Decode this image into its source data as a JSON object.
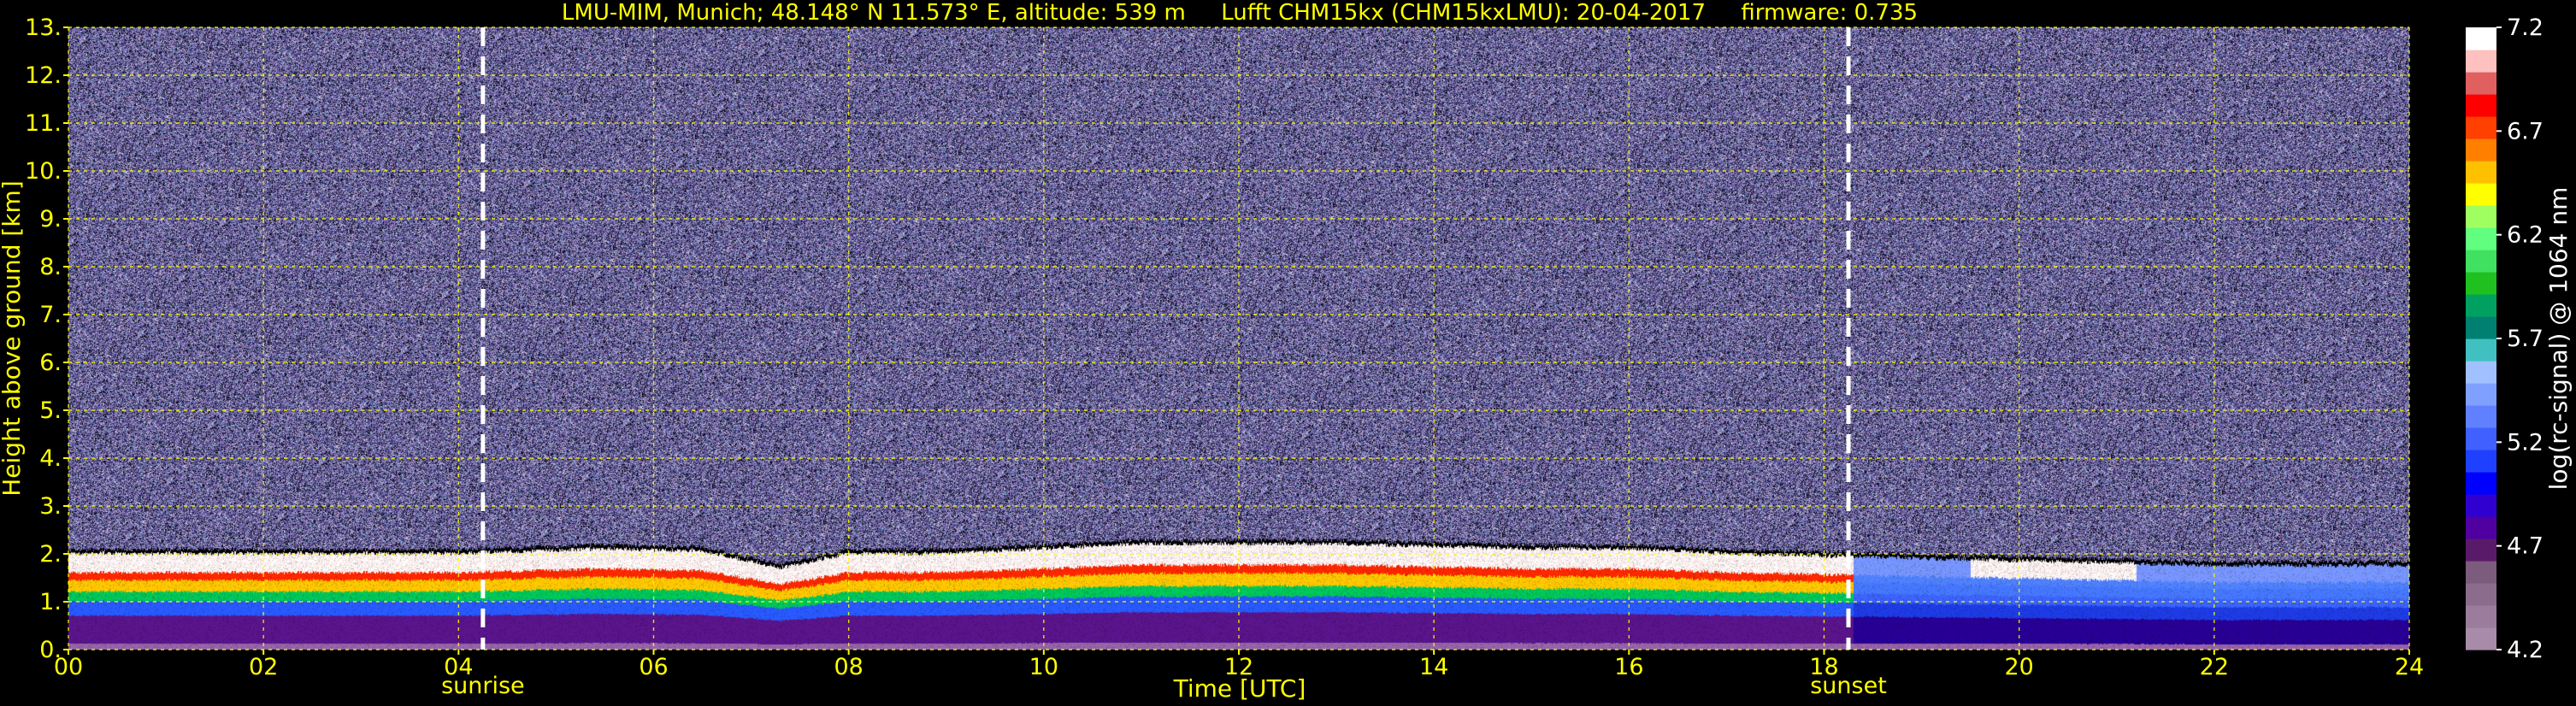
{
  "chart_data": {
    "type": "heatmap",
    "title": "LMU-MIM, Munich; 48.148° N 11.573° E, altitude: 539 m     Lufft CHM15kx (CHM15kxLMU): 20-04-2017     firmware: 0.735",
    "xlabel": "Time [UTC]",
    "ylabel": "Height above ground [km]",
    "xlim": [
      0,
      24
    ],
    "ylim": [
      0,
      13
    ],
    "x_ticks": [
      "00",
      "02",
      "04",
      "06",
      "08",
      "10",
      "12",
      "14",
      "16",
      "18",
      "20",
      "22",
      "24"
    ],
    "y_ticks": [
      "0.",
      "1.",
      "2.",
      "3.",
      "4.",
      "5.",
      "6.",
      "7.",
      "8.",
      "9.",
      "10.",
      "11.",
      "12.",
      "13."
    ],
    "grid": true,
    "event_lines": [
      {
        "label": "sunrise",
        "time": 4.25
      },
      {
        "label": "sunset",
        "time": 18.25
      }
    ],
    "colorbar": {
      "label": "log(rc-signal) @ 1064 nm",
      "range": [
        4.2,
        7.2
      ],
      "ticks": [
        "7.2",
        "6.7",
        "6.2",
        "5.7",
        "5.2",
        "4.7",
        "4.2"
      ],
      "colors": [
        "#a88ba8",
        "#9c7c9c",
        "#8c6c8c",
        "#7c5c7c",
        "#5a1a6a",
        "#5000a0",
        "#3000d0",
        "#0000ff",
        "#2040ff",
        "#4060ff",
        "#6080ff",
        "#80a0ff",
        "#a0c0ff",
        "#40c0c0",
        "#008070",
        "#00a060",
        "#20c020",
        "#40e060",
        "#60ff80",
        "#a0ff60",
        "#ffff00",
        "#ffc000",
        "#ff8000",
        "#ff4000",
        "#ff0000",
        "#e06060",
        "#ffc0c0",
        "#ffffff"
      ]
    },
    "boundary_layer_top_km": [
      [
        0,
        2.0
      ],
      [
        2,
        2.0
      ],
      [
        4,
        2.0
      ],
      [
        5.5,
        2.1
      ],
      [
        6.5,
        2.05
      ],
      [
        7.3,
        1.7
      ],
      [
        8,
        2.0
      ],
      [
        9,
        2.0
      ],
      [
        10,
        2.1
      ],
      [
        11,
        2.2
      ],
      [
        12,
        2.2
      ],
      [
        13,
        2.2
      ],
      [
        14,
        2.15
      ],
      [
        15,
        2.1
      ],
      [
        16,
        2.1
      ],
      [
        17,
        2.0
      ],
      [
        18,
        1.95
      ],
      [
        19,
        1.9
      ],
      [
        20,
        1.85
      ],
      [
        21,
        1.8
      ],
      [
        22,
        1.75
      ],
      [
        24,
        1.75
      ]
    ]
  }
}
